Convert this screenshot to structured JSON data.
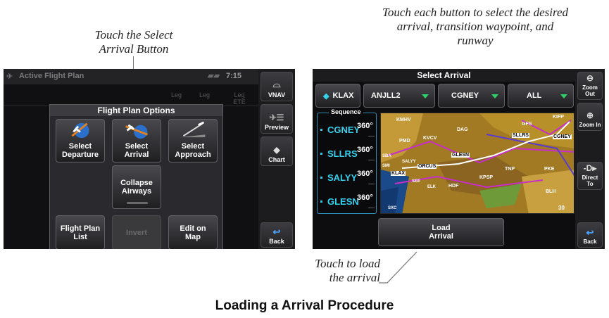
{
  "callouts": {
    "select_arrival": [
      "Touch the Select",
      "Arrival Button"
    ],
    "select_each": [
      "Touch each button to select the desired",
      "arrival, transition waypoint, and",
      "runway"
    ],
    "load": [
      "Touch to load",
      "the arrival"
    ]
  },
  "caption": "Loading a Arrival Procedure",
  "left_screen": {
    "title": "Active Flight Plan",
    "clock": "7:15",
    "col_headers": [
      "Leg",
      "Leg",
      "Leg ETE"
    ],
    "popup_title": "Flight Plan Options",
    "buttons": {
      "select_departure": "Select Departure",
      "select_arrival": "Select Arrival",
      "select_approach": "Select Approach",
      "collapse_airways": "Collapse Airways",
      "flight_plan_list": "Flight Plan List",
      "invert": "Invert",
      "edit_on_map": "Edit on Map"
    },
    "side": {
      "vnav": "VNAV",
      "preview": "Preview",
      "chart": "Chart",
      "back": "Back"
    }
  },
  "right_screen": {
    "title": "Select Arrival",
    "airport": "KLAX",
    "arrival": "ANJLL2",
    "transition": "CGNEY",
    "runway": "ALL",
    "sequence_label": "Sequence",
    "sequence": [
      {
        "wp": "CGNEY",
        "hdg": "360°",
        "dist": "__"
      },
      {
        "wp": "SLLRS",
        "hdg": "360°",
        "dist": "__"
      },
      {
        "wp": "SALYY",
        "hdg": "360°",
        "dist": "__"
      },
      {
        "wp": "GLESN",
        "hdg": "360°",
        "dist": "__"
      }
    ],
    "map_labels": [
      "KMHV",
      "DAG",
      "GFS",
      "KIFP",
      "PMD",
      "KVCV",
      "SLLRS",
      "CGNEY",
      "SBA",
      "SALYY",
      "GLESN",
      "SMI",
      "ORCUS",
      "KLAX",
      "TNP",
      "PKE",
      "SXC",
      "SEE",
      "HDF",
      "KPSP",
      "BLH",
      "ELK",
      "30"
    ],
    "load_button": "Load Arrival",
    "side": {
      "zoom_out": "Zoom Out",
      "zoom_in": "Zoom In",
      "direct_to": "Direct To",
      "back": "Back"
    }
  },
  "colors": {
    "accent_cyan": "#34d1ec",
    "accent_green": "#2fd16a",
    "map_terrain": "#b8902a",
    "route_magenta": "#d21ed2"
  }
}
